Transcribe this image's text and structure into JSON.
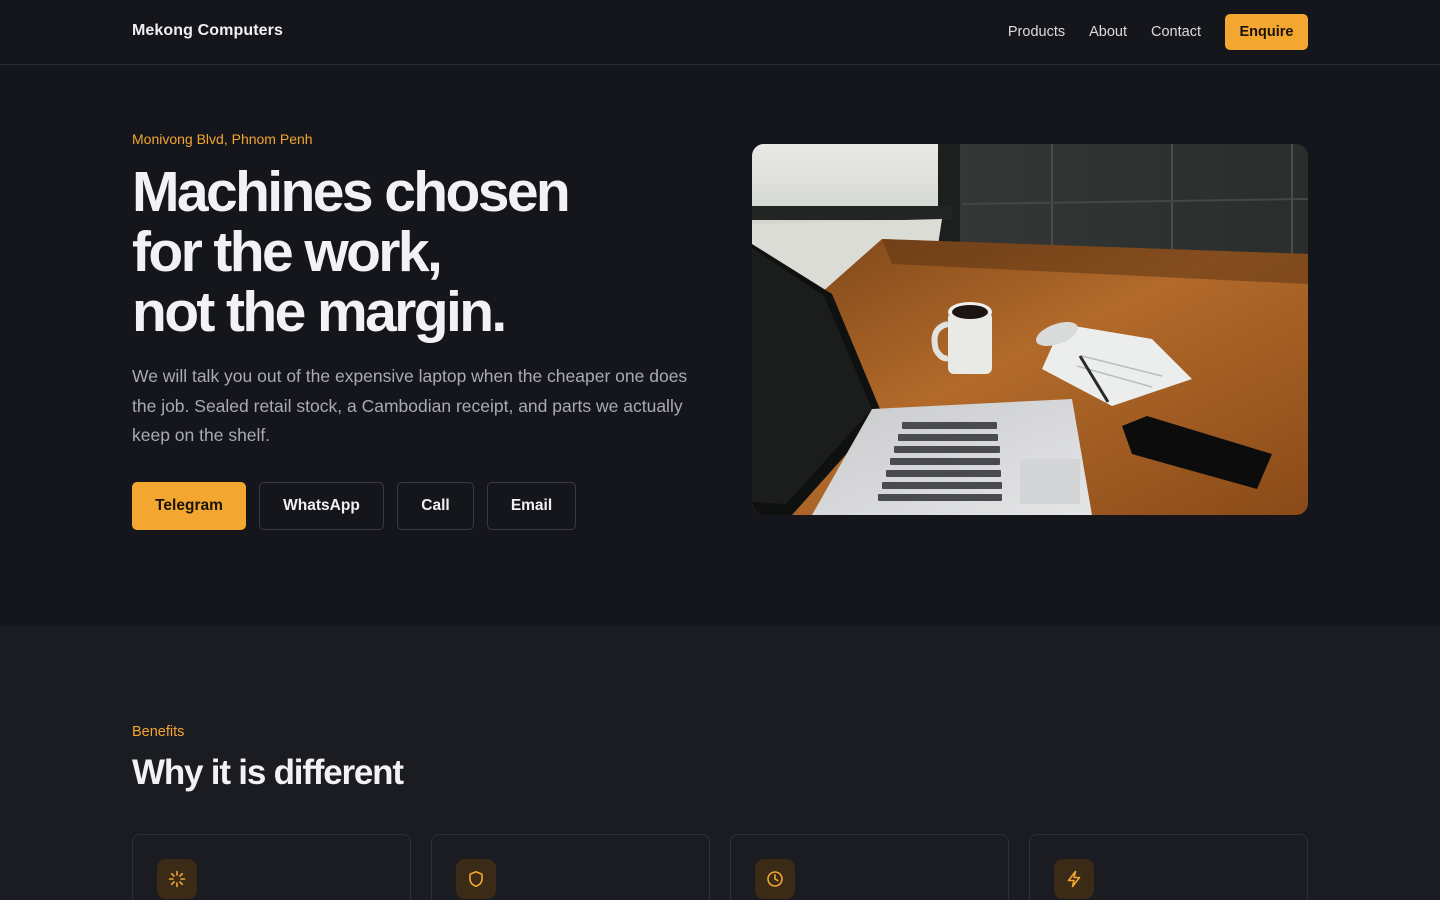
{
  "nav": {
    "brand": "Mekong Computers",
    "links": [
      "Products",
      "About",
      "Contact"
    ],
    "cta": "Enquire"
  },
  "hero": {
    "eyebrow": "Monivong Blvd, Phnom Penh",
    "title_lines": [
      "Machines chosen",
      "for the work,",
      "not the margin."
    ],
    "description": "We will talk you out of the expensive laptop when the cheaper one does the job. Sealed retail stock, a Cambodian receipt, and parts we actually keep on the shelf.",
    "ctas": [
      "Telegram",
      "WhatsApp",
      "Call",
      "Email"
    ],
    "image_alt": "laptop-coffee-desk-photo"
  },
  "benefits": {
    "eyebrow": "Benefits",
    "title": "Why it is different",
    "cards": [
      {
        "icon": "sparkle-icon"
      },
      {
        "icon": "shield-icon"
      },
      {
        "icon": "clock-icon"
      },
      {
        "icon": "bolt-icon"
      }
    ]
  },
  "colors": {
    "accent": "#f3a630",
    "background": "#15161b",
    "section_background": "#1a1c22"
  }
}
